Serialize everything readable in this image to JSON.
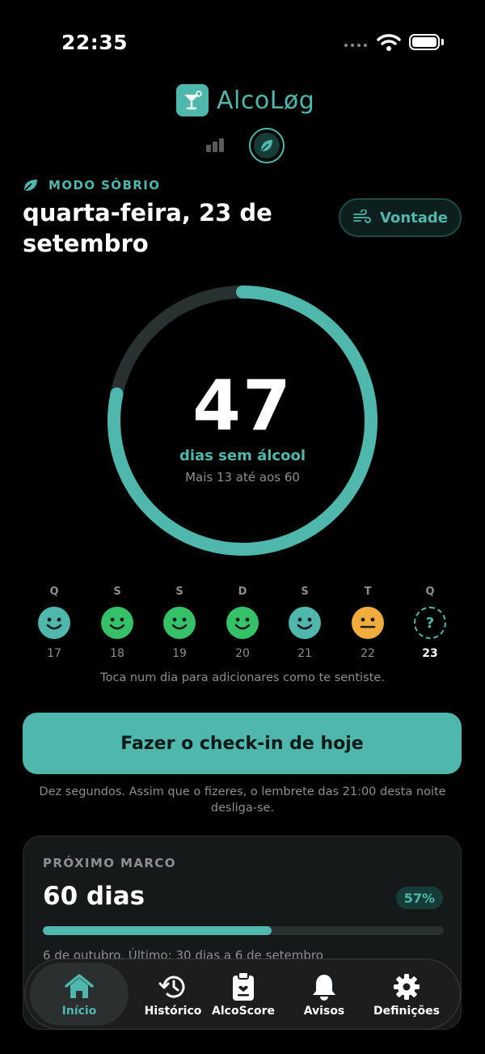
{
  "status_bar": {
    "time": "22:35"
  },
  "app": {
    "name": "AlcoLøg"
  },
  "header": {
    "mode_label": "MODO SÓBRIO",
    "date": "quarta-feira, 23 de setembro",
    "urge_button": "Vontade"
  },
  "counter": {
    "days": "47",
    "label": "dias sem álcool",
    "subtitle": "Mais 13 até aos 60",
    "progress_fraction": 0.783
  },
  "week": {
    "days": [
      {
        "letter": "Q",
        "date": "17",
        "mood": "ok",
        "color": "#4fb7ac"
      },
      {
        "letter": "S",
        "date": "18",
        "mood": "good",
        "color": "#35c168"
      },
      {
        "letter": "S",
        "date": "19",
        "mood": "good",
        "color": "#35c168"
      },
      {
        "letter": "D",
        "date": "20",
        "mood": "good",
        "color": "#35c168"
      },
      {
        "letter": "S",
        "date": "21",
        "mood": "ok",
        "color": "#4fb7ac"
      },
      {
        "letter": "T",
        "date": "22",
        "mood": "neutral",
        "color": "#f0ad3e"
      },
      {
        "letter": "Q",
        "date": "23",
        "mood": "unknown",
        "symbol": "?"
      }
    ],
    "hint": "Toca num dia para adicionares como te sentiste."
  },
  "checkin": {
    "button": "Fazer o check-in de hoje",
    "note": "Dez segundos. Assim que o fizeres, o lembrete das 21:00 desta noite desliga-se."
  },
  "milestone": {
    "label": "PRÓXIMO MARCO",
    "value": "60 dias",
    "percent": "57%",
    "progress_fraction": 0.57,
    "footer": "6 de outubro. Último: 30 dias a 6 de setembro"
  },
  "tabbar": {
    "tabs": [
      {
        "label": "Início",
        "icon": "home-icon",
        "active": true
      },
      {
        "label": "Histórico",
        "icon": "history-icon"
      },
      {
        "label": "AlcoScore",
        "icon": "clipboard-heart-icon"
      },
      {
        "label": "Avisos",
        "icon": "bell-icon"
      },
      {
        "label": "Definições",
        "icon": "gear-icon"
      }
    ]
  },
  "colors": {
    "accent": "#4fb7ac",
    "good": "#35c168",
    "neutral": "#f0ad3e",
    "background": "#000000"
  }
}
